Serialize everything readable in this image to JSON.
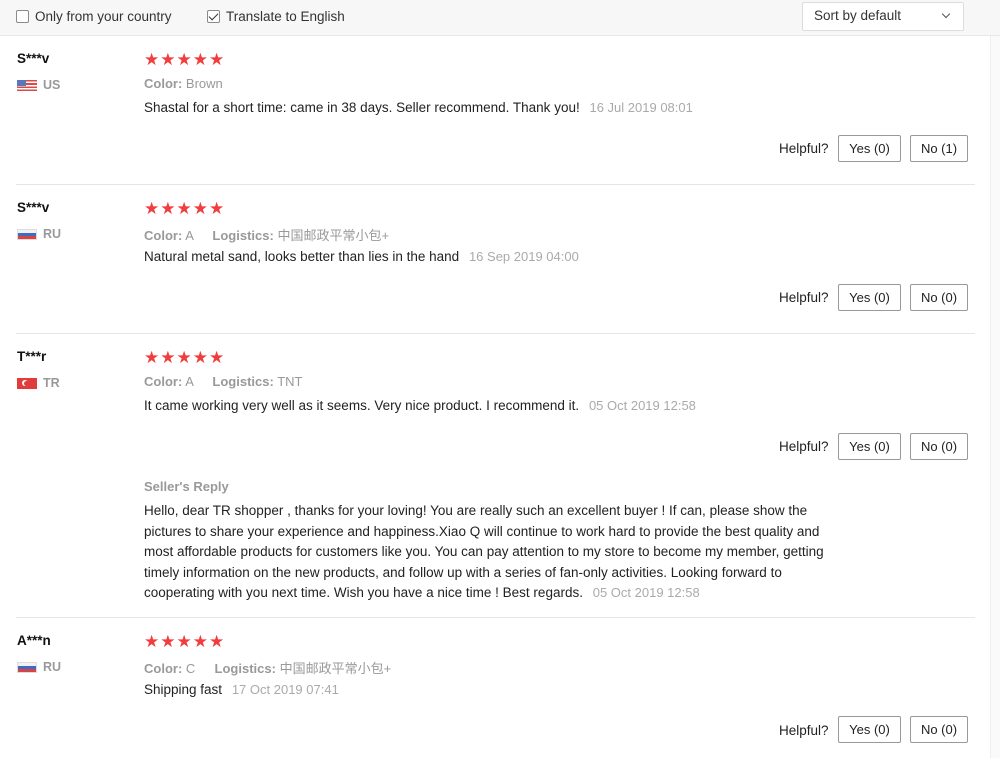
{
  "filters": {
    "only_country_label": "Only from your country",
    "only_country_checked": false,
    "translate_label": "Translate to English",
    "translate_checked": true
  },
  "sort": {
    "selected": "Sort by default"
  },
  "helpful_label": "Helpful?",
  "reviews": [
    {
      "user": "S***v",
      "country": "US",
      "rating": 5,
      "stars": "★★★★★",
      "color_key": "Color:",
      "color_val": "Brown",
      "text": "Shastal for a short time: came in 38 days. Seller recommend. Thank you!",
      "date": "16 Jul 2019 08:01",
      "yes": "Yes (0)",
      "no": "No (1)"
    },
    {
      "user": "S***v",
      "country": "RU",
      "rating": 5,
      "stars": "★★★★★",
      "color_key": "Color:",
      "color_val": "A",
      "logistics_key": "Logistics:",
      "logistics_val": "中国邮政平常小包+",
      "text": "Natural metal sand, looks better than lies in the hand",
      "date": "16 Sep 2019 04:00",
      "yes": "Yes (0)",
      "no": "No (0)"
    },
    {
      "user": "T***r",
      "country": "TR",
      "rating": 5,
      "stars": "★★★★★",
      "color_key": "Color:",
      "color_val": "A",
      "logistics_key": "Logistics:",
      "logistics_val": "TNT",
      "text": "It came working very well as it seems. Very nice product. I recommend it.",
      "date": "05 Oct 2019 12:58",
      "yes": "Yes (0)",
      "no": "No (0)",
      "reply": {
        "title": "Seller's Reply",
        "text": "Hello, dear TR shopper , thanks for your loving! You are really such an excellent buyer ! If can, please show the pictures to share your experience and happiness.Xiao Q will continue to work hard to provide the best quality and most affordable products for customers like you. You can pay attention to my store to become my member, getting timely information on the new products, and follow up with a series of fan-only activities. Looking forward to cooperating with you next time. Wish you have a nice time ! Best regards.",
        "date": "05 Oct 2019 12:58"
      }
    },
    {
      "user": "A***n",
      "country": "RU",
      "rating": 5,
      "stars": "★★★★★",
      "color_key": "Color:",
      "color_val": "C",
      "logistics_key": "Logistics:",
      "logistics_val": "中国邮政平常小包+",
      "text": "Shipping fast",
      "date": "17 Oct 2019 07:41",
      "yes": "Yes (0)",
      "no": "No (0)"
    }
  ],
  "colors": {
    "star": "#f03e3e",
    "muted": "#999999"
  }
}
